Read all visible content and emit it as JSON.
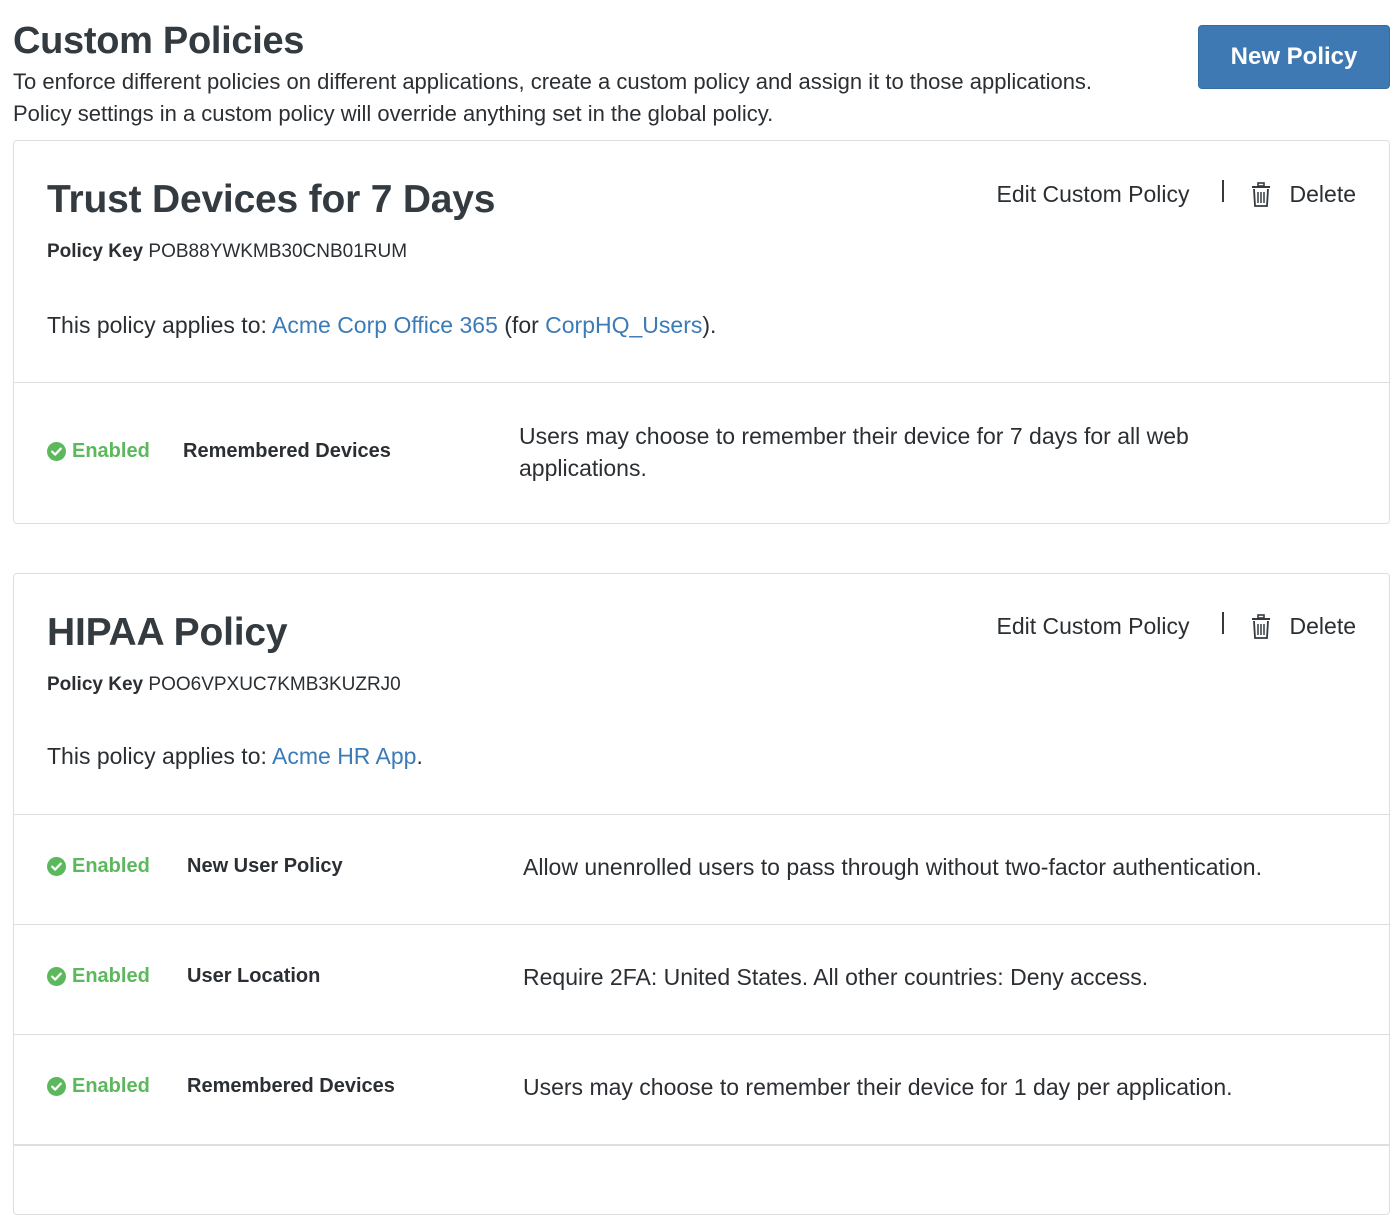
{
  "header": {
    "title": "Custom Policies",
    "description_line1": "To enforce different policies on different applications, create a custom policy and assign it to those applications.",
    "description_line2": "Policy settings in a custom policy will override anything set in the global policy.",
    "new_policy_label": "New Policy"
  },
  "colors": {
    "primary_button": "#3f79b3",
    "link": "#3b7bb8",
    "enabled": "#5cb85c"
  },
  "policies": [
    {
      "name": "Trust Devices for 7 Days",
      "key_label": "Policy Key",
      "key_value": "POB88YWKMB30CNB01RUM",
      "applies_prefix": "This policy applies to: ",
      "app_link": "Acme Corp Office 365",
      "for_prefix": " (for ",
      "group_link": "CorpHQ_Users",
      "applies_suffix": ").",
      "edit_label": "Edit Custom Policy",
      "delete_label": "Delete",
      "settings": [
        {
          "status": "Enabled",
          "name": "Remembered Devices",
          "description": "Users may choose to remember their device for 7 days for all web applications."
        }
      ]
    },
    {
      "name": "HIPAA Policy",
      "key_label": "Policy Key",
      "key_value": "POO6VPXUC7KMB3KUZRJ0",
      "applies_prefix": "This policy applies to: ",
      "app_link": "Acme HR App",
      "applies_suffix": ".",
      "edit_label": "Edit Custom Policy",
      "delete_label": "Delete",
      "settings": [
        {
          "status": "Enabled",
          "name": "New User Policy",
          "description": "Allow unenrolled users to pass through without two-factor authentication."
        },
        {
          "status": "Enabled",
          "name": "User Location",
          "description": "Require 2FA: United States. All other countries: Deny access."
        },
        {
          "status": "Enabled",
          "name": "Remembered Devices",
          "description": "Users may choose to remember their device for 1 day per application."
        }
      ]
    }
  ]
}
